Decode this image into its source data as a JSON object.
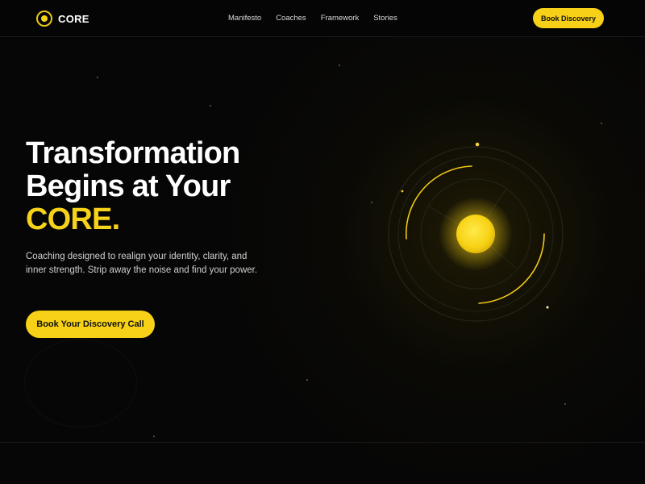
{
  "brand": {
    "name": "CORE",
    "accent": "#f6d117"
  },
  "nav": {
    "items": [
      {
        "label": "Manifesto"
      },
      {
        "label": "Coaches"
      },
      {
        "label": "Framework"
      },
      {
        "label": "Stories"
      }
    ],
    "cta_label": "Book Discovery"
  },
  "hero": {
    "title_line1": "Transformation",
    "title_line2": "Begins at Your",
    "title_accent": "CORE.",
    "subtitle": "Coaching designed to realign your identity, clarity, and inner strength. Strip away the noise and find your power.",
    "cta_label": "Book Your Discovery Call"
  },
  "icons": {
    "logo": "target-circle-icon",
    "illustration": "glowing-sun-orbit-icon"
  }
}
